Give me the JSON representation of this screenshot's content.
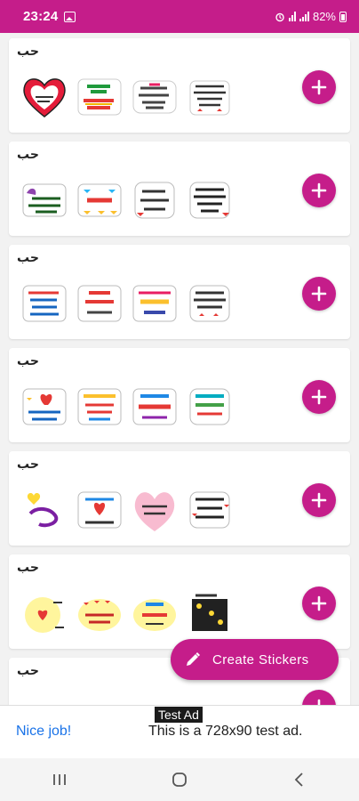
{
  "status_bar": {
    "time": "23:24",
    "battery": "82%",
    "color": "#c51d8a"
  },
  "packs": [
    {
      "title": "حب"
    },
    {
      "title": "حب"
    },
    {
      "title": "حب"
    },
    {
      "title": "حب"
    },
    {
      "title": "حب"
    },
    {
      "title": "حب"
    },
    {
      "title": "حب"
    }
  ],
  "add_icon": "plus-icon",
  "fab": {
    "label": "Create Stickers",
    "icon": "pencil-icon"
  },
  "ad": {
    "tag": "Test Ad",
    "nice": "Nice job!",
    "text": "This is a 728x90 test ad."
  },
  "nav": {
    "recents": "recents-icon",
    "home": "home-icon",
    "back": "back-icon"
  },
  "accent": "#c51d8a"
}
